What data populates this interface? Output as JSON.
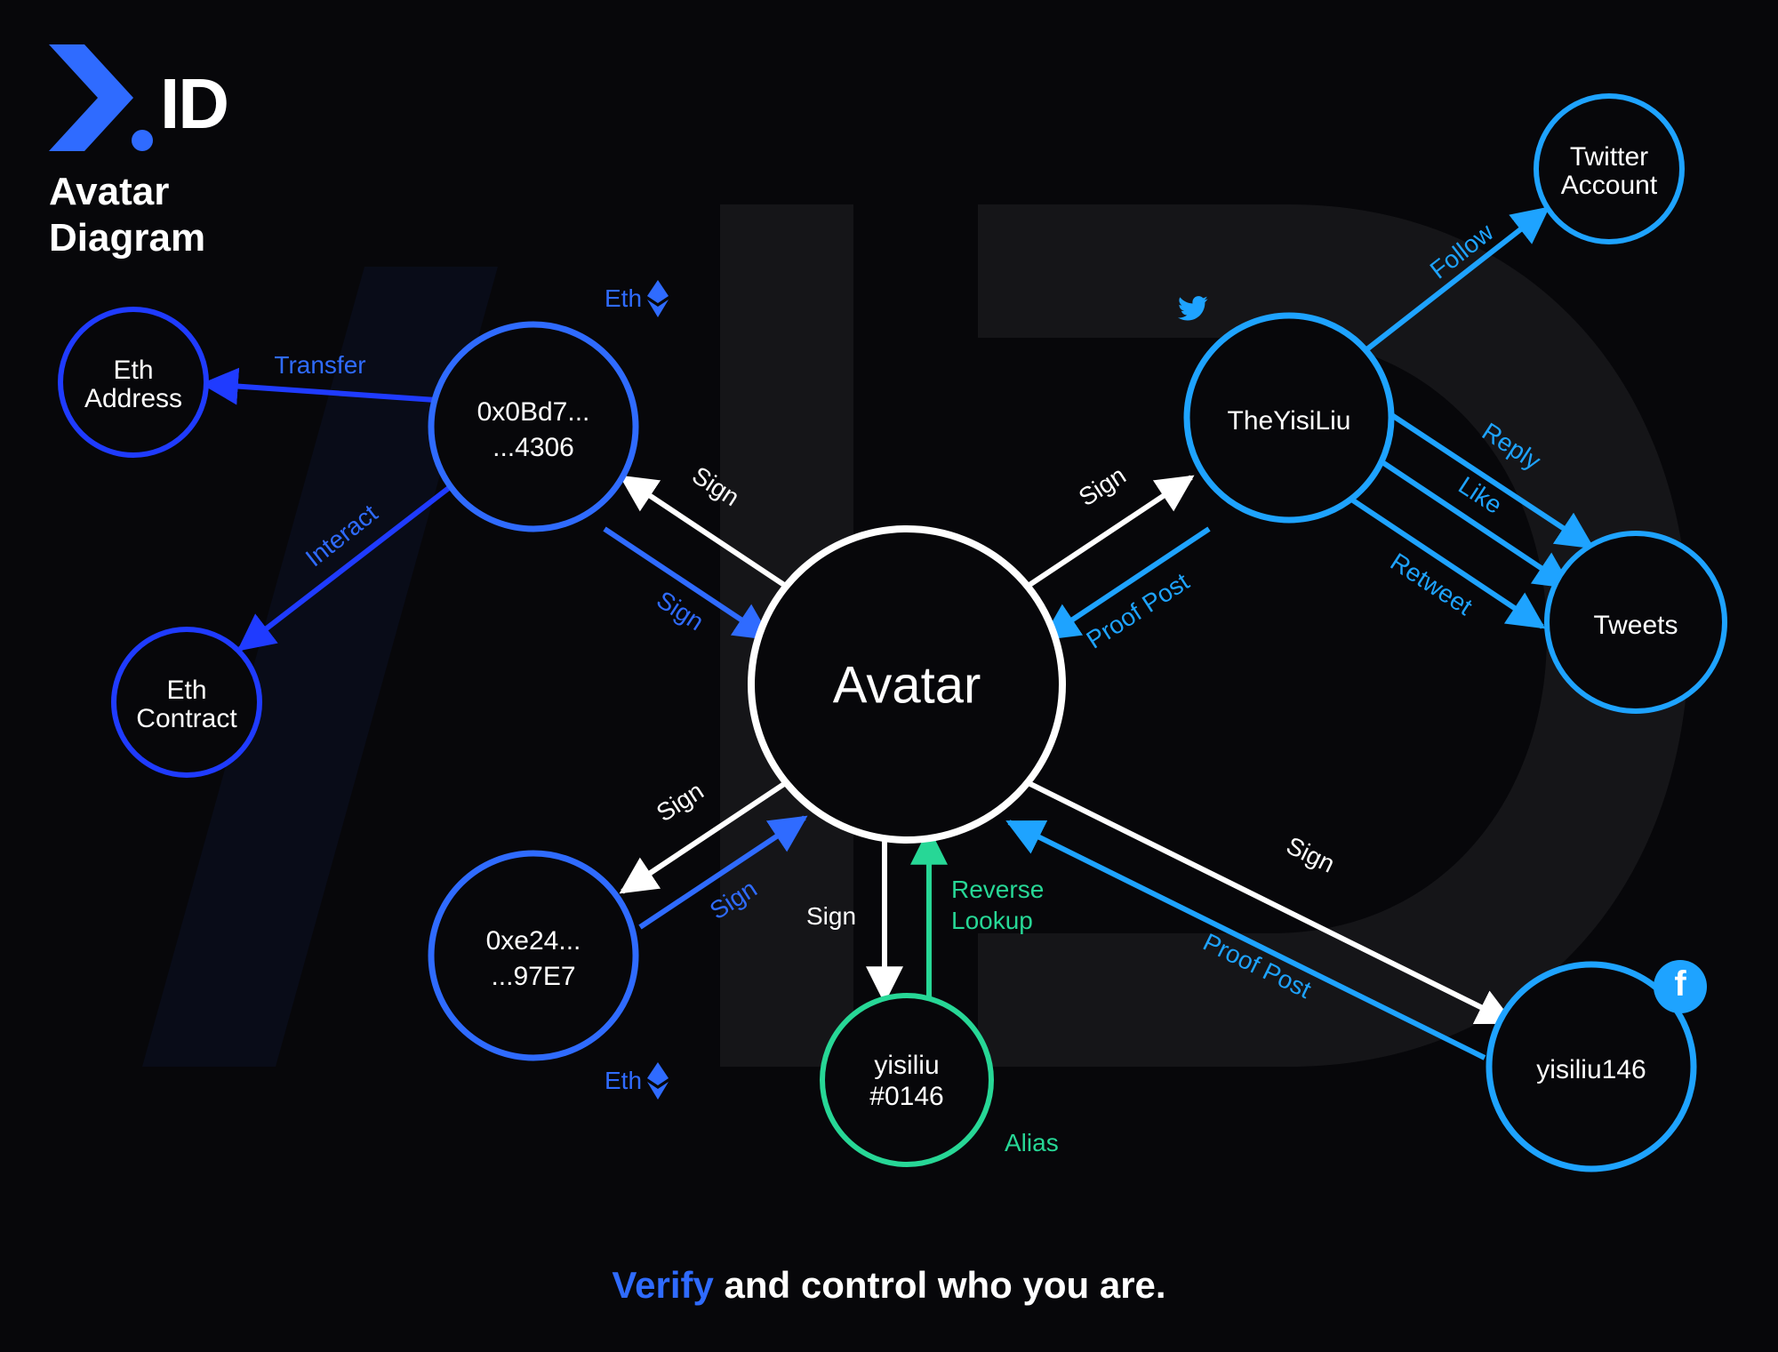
{
  "logo": {
    "text": "ID",
    "subtitle_line1": "Avatar",
    "subtitle_line2": "Diagram"
  },
  "colors": {
    "bg": "#07070a",
    "white": "#ffffff",
    "blue_deep": "#1f3bff",
    "blue_mid": "#2f6bff",
    "blue_light": "#1ea3ff",
    "green": "#27d796"
  },
  "nodes": {
    "avatar": {
      "label": "Avatar"
    },
    "eth1": {
      "line1": "0x0Bd7...",
      "line2": "...4306",
      "tag": "Eth"
    },
    "eth2": {
      "line1": "0xe24...",
      "line2": "...97E7",
      "tag": "Eth"
    },
    "eth_address": {
      "line1": "Eth",
      "line2": "Address"
    },
    "eth_contract": {
      "line1": "Eth",
      "line2": "Contract"
    },
    "twitter": {
      "label": "TheYisiLiu"
    },
    "twitter_acct": {
      "line1": "Twitter",
      "line2": "Account"
    },
    "tweets": {
      "label": "Tweets"
    },
    "facebook": {
      "label": "yisiliu146"
    },
    "alias": {
      "line1": "yisiliu",
      "line2": "#0146",
      "tag": "Alias"
    }
  },
  "edges": {
    "sign": "Sign",
    "transfer": "Transfer",
    "interact": "Interact",
    "proof_post": "Proof Post",
    "follow": "Follow",
    "reply": "Reply",
    "like": "Like",
    "retweet": "Retweet",
    "reverse_lookup_l1": "Reverse",
    "reverse_lookup_l2": "Lookup"
  },
  "tagline": {
    "pre": "Verify ",
    "post": "and control who you are."
  }
}
